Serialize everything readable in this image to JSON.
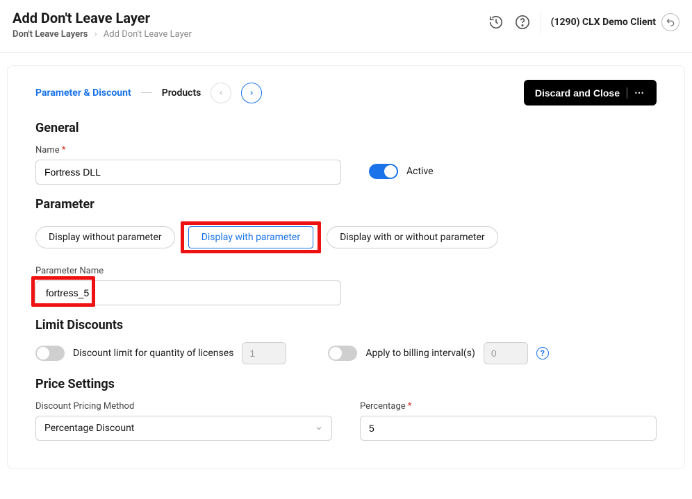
{
  "header": {
    "title": "Add Don't Leave Layer",
    "breadcrumb_link": "Don't Leave Layers",
    "breadcrumb_current": "Add Don't Leave Layer",
    "client": "(1290) CLX Demo Client"
  },
  "wizard": {
    "step1": "Parameter & Discount",
    "step2": "Products",
    "discard": "Discard and Close"
  },
  "general": {
    "heading": "General",
    "name_label": "Name",
    "name_value": "Fortress DLL",
    "active_label": "Active"
  },
  "parameter": {
    "heading": "Parameter",
    "opt_without": "Display without parameter",
    "opt_with": "Display with parameter",
    "opt_either": "Display with or without parameter",
    "name_label": "Parameter Name",
    "name_value": "fortress_5"
  },
  "limits": {
    "heading": "Limit Discounts",
    "qty_label": "Discount limit for quantity of licenses",
    "qty_value": "1",
    "interval_label": "Apply to billing interval(s)",
    "interval_value": "0"
  },
  "price": {
    "heading": "Price Settings",
    "method_label": "Discount Pricing Method",
    "method_value": "Percentage Discount",
    "pct_label": "Percentage",
    "pct_value": "5"
  }
}
